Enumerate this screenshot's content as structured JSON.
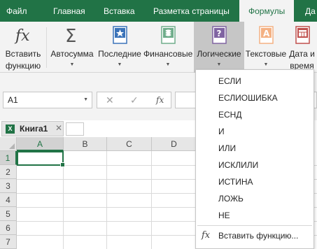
{
  "tabs": [
    "Файл",
    "Главная",
    "Вставка",
    "Разметка страницы",
    "Формулы",
    "Да"
  ],
  "active_tab": "Формулы",
  "ribbon": {
    "insert_function": [
      "Вставить",
      "функцию"
    ],
    "autosum": "Автосумма",
    "recent": "Последние",
    "financial": "Финансовые",
    "logical": "Логические",
    "text": "Текстовые",
    "datetime": [
      "Дата и",
      "время"
    ],
    "fx_glyph": "fx",
    "sigma_glyph": "Σ"
  },
  "formula_bar": {
    "name_box": "A1",
    "cancel": "✕",
    "enter": "✓",
    "fx": "fx",
    "value": ""
  },
  "workbook": {
    "name": "Книга1",
    "xl_badge": "X",
    "close": "✕"
  },
  "grid": {
    "columns": [
      "A",
      "B",
      "C",
      "D"
    ],
    "rows": [
      "1",
      "2",
      "3",
      "4",
      "5",
      "6",
      "7"
    ],
    "selected_cell": "A1"
  },
  "logical_menu": {
    "items": [
      "ЕСЛИ",
      "ЕСЛИОШИБКА",
      "ЕСНД",
      "И",
      "ИЛИ",
      "ИСКЛИЛИ",
      "ИСТИНА",
      "ЛОЖЬ",
      "НЕ"
    ],
    "footer": "Вставить функцию...",
    "footer_icon": "fx"
  },
  "colors": {
    "brand": "#217346",
    "logical_icon": "#8064a2",
    "text_icon": "#f4b183",
    "financial_icon": "#70ad8b"
  }
}
